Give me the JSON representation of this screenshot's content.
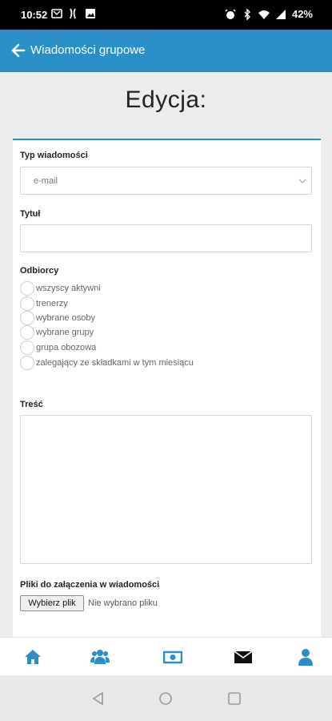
{
  "status_bar": {
    "time": "10:52",
    "battery": "42%",
    "left_icons": [
      "outlook-icon",
      "fitness-icon",
      "image-icon"
    ],
    "right_icons": [
      "alarm-icon",
      "bluetooth-icon",
      "wifi-icon",
      "signal-icon",
      "battery-icon"
    ]
  },
  "app_bar": {
    "title": "Wiadomości grupowe",
    "back_icon": "arrow-left-icon",
    "background": "#2b8fc7"
  },
  "page": {
    "heading": "Edycja:"
  },
  "form": {
    "type_label": "Typ wiadomości",
    "type_value": "e-mail",
    "title_label": "Tytuł",
    "title_value": "",
    "recipients_label": "Odbiorcy",
    "recipients": [
      "wszyscy aktywni",
      "trenerzy",
      "wybrane osoby",
      "wybrane grupy",
      "grupa obozowa",
      "zalegający ze składkami w tym miesiącu"
    ],
    "content_label": "Treść",
    "content_value": "",
    "attachments_label": "Pliki do załączenia w wiadomości",
    "file_button": "Wybierz plik",
    "file_status": "Nie wybrano pliku"
  },
  "bottom_nav": {
    "items": [
      "home-icon",
      "users-icon",
      "money-icon",
      "envelope-icon",
      "user-icon"
    ],
    "accent": "#2b8fc7",
    "active_color": "#111111"
  },
  "system_nav": [
    "back-triangle-icon",
    "home-circle-icon",
    "recents-square-icon"
  ]
}
